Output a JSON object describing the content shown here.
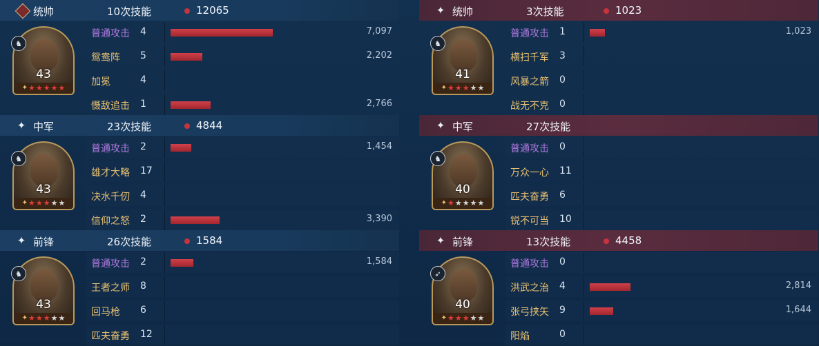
{
  "teams": [
    {
      "side": "left",
      "generals": [
        {
          "role": "统帅",
          "role_icon": "diamond-general-icon",
          "skill_count": "10次技能",
          "damage": "12065",
          "level": "43",
          "troop_icon": "cavalry-icon",
          "stars_red": 5,
          "skills": [
            {
              "name": "普通攻击",
              "count": "4",
              "value": "7,097",
              "bar": 7097,
              "basic": true
            },
            {
              "name": "鸳鸯阵",
              "count": "5",
              "value": "2,202",
              "bar": 2202
            },
            {
              "name": "加冕",
              "count": "4",
              "value": "",
              "bar": 0
            },
            {
              "name": "慑敌追击",
              "count": "1",
              "value": "2,766",
              "bar": 2766
            }
          ]
        },
        {
          "role": "中军",
          "role_icon": "sparkle-icon",
          "skill_count": "23次技能",
          "damage": "4844",
          "level": "43",
          "troop_icon": "cavalry-icon",
          "stars_red": 3,
          "skills": [
            {
              "name": "普通攻击",
              "count": "2",
              "value": "1,454",
              "bar": 1454,
              "basic": true
            },
            {
              "name": "雄才大略",
              "count": "17",
              "value": "",
              "bar": 0
            },
            {
              "name": "决水千仞",
              "count": "4",
              "value": "",
              "bar": 0
            },
            {
              "name": "信仰之怒",
              "count": "2",
              "value": "3,390",
              "bar": 3390
            }
          ]
        },
        {
          "role": "前锋",
          "role_icon": "sparkle-icon",
          "skill_count": "26次技能",
          "damage": "1584",
          "level": "43",
          "troop_icon": "cavalry-icon",
          "stars_red": 3,
          "skills": [
            {
              "name": "普通攻击",
              "count": "2",
              "value": "1,584",
              "bar": 1584,
              "basic": true
            },
            {
              "name": "王者之师",
              "count": "8",
              "value": "",
              "bar": 0
            },
            {
              "name": "回马枪",
              "count": "6",
              "value": "",
              "bar": 0
            },
            {
              "name": "匹夫奋勇",
              "count": "12",
              "value": "",
              "bar": 0
            }
          ]
        }
      ]
    },
    {
      "side": "right",
      "generals": [
        {
          "role": "统帅",
          "role_icon": "sparkle-icon",
          "skill_count": "3次技能",
          "damage": "1023",
          "level": "41",
          "troop_icon": "cavalry-icon",
          "stars_red": 3,
          "skills": [
            {
              "name": "普通攻击",
              "count": "1",
              "value": "1,023",
              "bar": 1023,
              "basic": true
            },
            {
              "name": "横扫千军",
              "count": "3",
              "value": "",
              "bar": 0
            },
            {
              "name": "风暴之箭",
              "count": "0",
              "value": "",
              "bar": 0
            },
            {
              "name": "战无不克",
              "count": "0",
              "value": "",
              "bar": 0
            }
          ]
        },
        {
          "role": "中军",
          "role_icon": "sparkle-icon",
          "skill_count": "27次技能",
          "damage": "",
          "level": "40",
          "troop_icon": "cavalry-icon",
          "stars_red": 1,
          "skills": [
            {
              "name": "普通攻击",
              "count": "0",
              "value": "",
              "bar": 0,
              "basic": true
            },
            {
              "name": "万众一心",
              "count": "11",
              "value": "",
              "bar": 0
            },
            {
              "name": "匹夫奋勇",
              "count": "6",
              "value": "",
              "bar": 0
            },
            {
              "name": "锐不可当",
              "count": "10",
              "value": "",
              "bar": 0
            }
          ]
        },
        {
          "role": "前锋",
          "role_icon": "sparkle-icon",
          "skill_count": "13次技能",
          "damage": "4458",
          "level": "40",
          "troop_icon": "archer-icon",
          "stars_red": 3,
          "skills": [
            {
              "name": "普通攻击",
              "count": "0",
              "value": "",
              "bar": 0,
              "basic": true
            },
            {
              "name": "洪武之治",
              "count": "4",
              "value": "2,814",
              "bar": 2814
            },
            {
              "name": "张弓挟矢",
              "count": "9",
              "value": "1,644",
              "bar": 1644
            },
            {
              "name": "阳焰",
              "count": "0",
              "value": "",
              "bar": 0
            }
          ]
        }
      ]
    }
  ],
  "bar_max_value": 7097,
  "colors": {
    "bar": "#c8343e",
    "skill_gold": "#e8c070",
    "skill_basic": "#b07ae0",
    "header_left": "#183a5c",
    "header_right": "#5a2c3e"
  }
}
